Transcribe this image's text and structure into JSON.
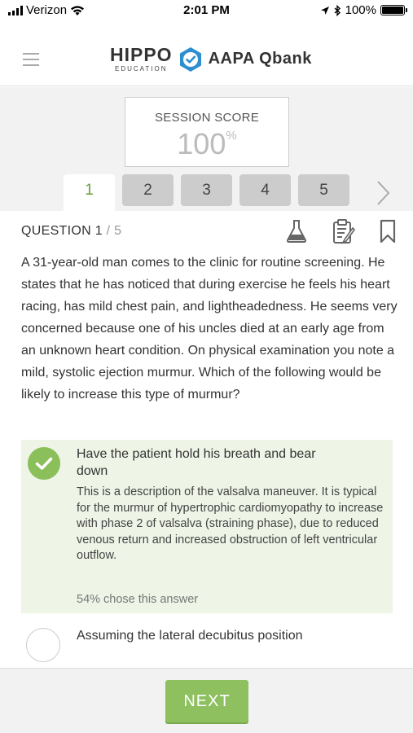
{
  "status_bar": {
    "carrier": "Verizon",
    "time": "2:01 PM",
    "battery": "100%"
  },
  "header": {
    "brand_main": "HIPPO",
    "brand_sub": "EDUCATION",
    "product": "AAPA Qbank"
  },
  "score": {
    "label": "SESSION SCORE",
    "value": "100",
    "unit": "%"
  },
  "tabs": [
    "1",
    "2",
    "3",
    "4",
    "5"
  ],
  "question": {
    "label": "QUESTION 1",
    "total": "/ 5",
    "text": "A 31-year-old man comes to the clinic for routine screening. He states that he has noticed that during exercise he feels his heart racing, has mild chest pain, and lightheadedness. He seems very concerned because one of his uncles died at an early age from an unknown heart condition. On physical examination you note a mild, systolic ejection murmur. Which of the following would be likely to increase this type of murmur?"
  },
  "answers": [
    {
      "text": "Have the patient hold his breath and bear down",
      "explanation": "This is a description of the valsalva maneuver. It is typical for the murmur of hypertrophic cardiomyopathy to increase with phase 2 of valsalva (straining phase), due to reduced venous return and increased obstruction of left ventricular outflow.",
      "percent": "54% chose this answer"
    },
    {
      "text": "Assuming the lateral decubitus position"
    }
  ],
  "footer": {
    "next_label": "NEXT"
  },
  "colors": {
    "accent_green": "#8ec05f",
    "correct_bg": "#eef4e6",
    "brand_blue": "#2e8fd0"
  }
}
